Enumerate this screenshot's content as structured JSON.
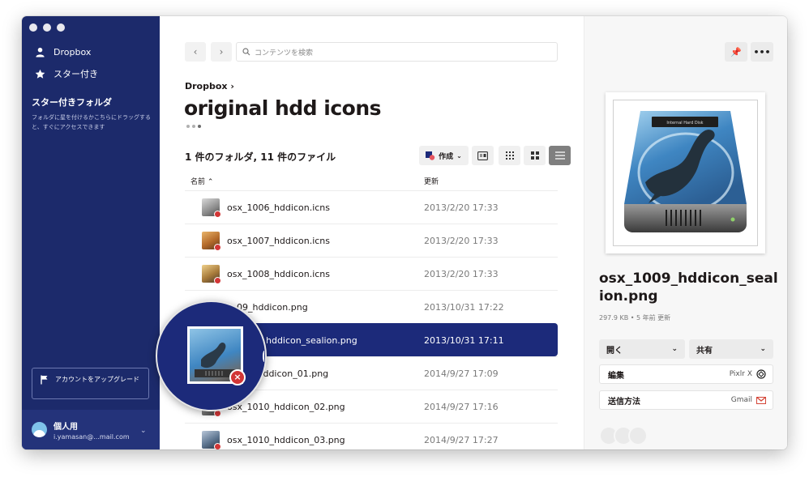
{
  "sidebar": {
    "items": [
      {
        "label": "Dropbox",
        "icon": "person-icon"
      },
      {
        "label": "スター付き",
        "icon": "star-icon"
      }
    ],
    "section_title": "スター付きフォルダ",
    "section_hint": "フォルダに星を付けるかこちらにドラッグすると、すぐにアクセスできます",
    "upgrade_label": "アカウントをアップグレード",
    "account": {
      "name": "個人用",
      "email": "i.yamasan@...mail.com"
    }
  },
  "main": {
    "search_placeholder": "コンテンツを検索",
    "breadcrumb": "Dropbox",
    "title": "original hdd icons",
    "count_text": "1 件のフォルダ, 11 件のファイル",
    "create_label": "作成",
    "columns": {
      "name": "名前",
      "modified": "更新"
    },
    "rows": [
      {
        "name": "osx_1006_hddicon.icns",
        "date": "2013/2/20 17:33"
      },
      {
        "name": "osx_1007_hddicon.icns",
        "date": "2013/2/20 17:33"
      },
      {
        "name": "osx_1008_hddicon.icns",
        "date": "2013/2/20 17:33"
      },
      {
        "name": "09_hddicon.png",
        "date": "2013/10/31 17:22"
      },
      {
        "name": "hddicon_sealion.png",
        "date": "2013/10/31 17:11"
      },
      {
        "name": "10_hddicon_01.png",
        "date": "2014/9/27 17:09"
      },
      {
        "name": "osx_1010_hddicon_02.png",
        "date": "2014/9/27 17:16"
      },
      {
        "name": "osx_1010_hddicon_03.png",
        "date": "2014/9/27 17:27"
      }
    ]
  },
  "panel": {
    "filename": "osx_1009_hddicon_sealion.png",
    "meta": "297.9 KB • 5 年前 更新",
    "open_label": "開く",
    "share_label": "共有",
    "edit_label": "編集",
    "edit_app": "Pixlr X",
    "send_label": "送信方法",
    "send_app": "Gmail",
    "preview_text": "Internal Hard Disk"
  }
}
